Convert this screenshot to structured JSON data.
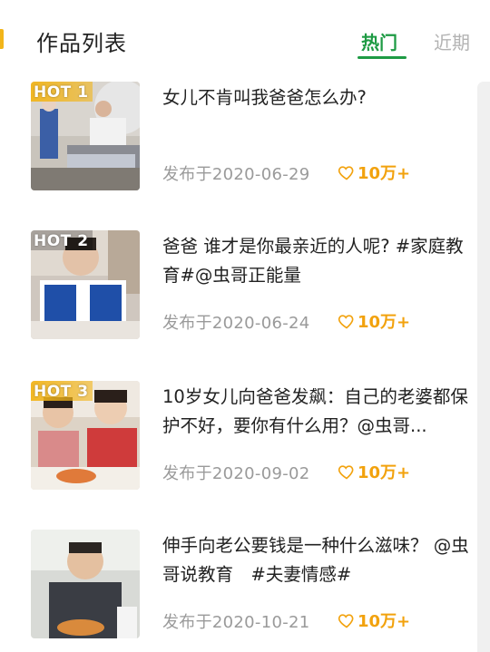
{
  "header": {
    "title": "作品列表",
    "tabs": [
      {
        "label": "热门",
        "active": true
      },
      {
        "label": "近期",
        "active": false
      }
    ]
  },
  "colors": {
    "accent": "#1e9b44",
    "badge_gold": "#f2b51a",
    "like": "#f2a20d",
    "muted": "#9a9a9a"
  },
  "items": [
    {
      "badge": "HOT 1",
      "title": "女儿不肯叫我爸爸怎么办?",
      "date": "发布于2020-06-29",
      "likes": "10万+",
      "like_icon": "heart-outline-icon"
    },
    {
      "badge": "HOT 2",
      "title": "爸爸 谁才是你最亲近的人呢? #家庭教育#@虫哥正能量",
      "date": "发布于2020-06-24",
      "likes": "10万+",
      "like_icon": "heart-outline-icon"
    },
    {
      "badge": "HOT 3",
      "title": "10岁女儿向爸爸发飙：自己的老婆都保护不好，要你有什么用？@虫哥...",
      "date": "发布于2020-09-02",
      "likes": "10万+",
      "like_icon": "heart-outline-icon"
    },
    {
      "badge": "",
      "title": "伸手向老公要钱是一种什么滋味？ @虫哥说教育　#夫妻情感#",
      "date": "发布于2020-10-21",
      "likes": "10万+",
      "like_icon": "heart-outline-icon"
    }
  ]
}
